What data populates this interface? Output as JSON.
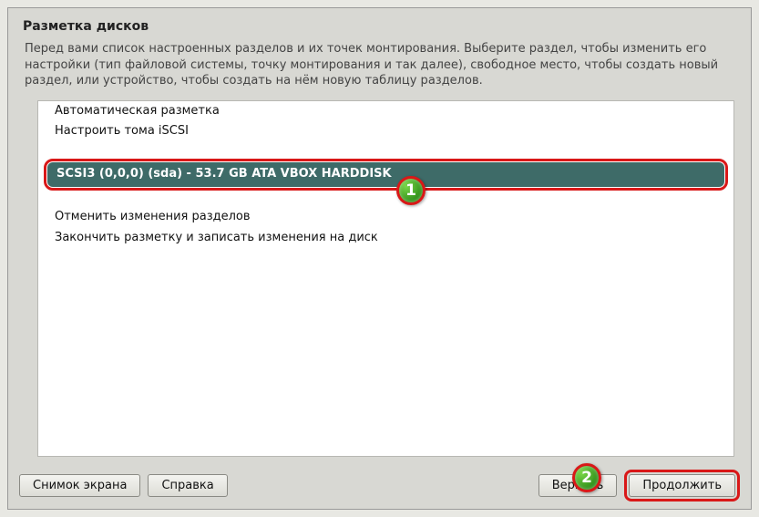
{
  "title": "Разметка дисков",
  "instructions": "Перед вами список настроенных разделов и их точек монтирования. Выберите раздел, чтобы изменить его настройки (тип файловой системы, точку монтирования и так далее), свободное место, чтобы создать новый раздел, или устройство, чтобы создать на нём новую таблицу разделов.",
  "list": {
    "guided": "Автоматическая разметка",
    "iscsi": "Настроить тома iSCSI",
    "disk_selected": "SCSI3 (0,0,0) (sda) - 53.7 GB ATA VBOX HARDDISK",
    "undo": "Отменить изменения разделов",
    "finish": "Закончить разметку и записать изменения на диск"
  },
  "buttons": {
    "screenshot": "Снимок экрана",
    "help": "Справка",
    "back": "Вернуть",
    "continue": "Продолжить"
  },
  "callouts": {
    "one": "1",
    "two": "2"
  }
}
